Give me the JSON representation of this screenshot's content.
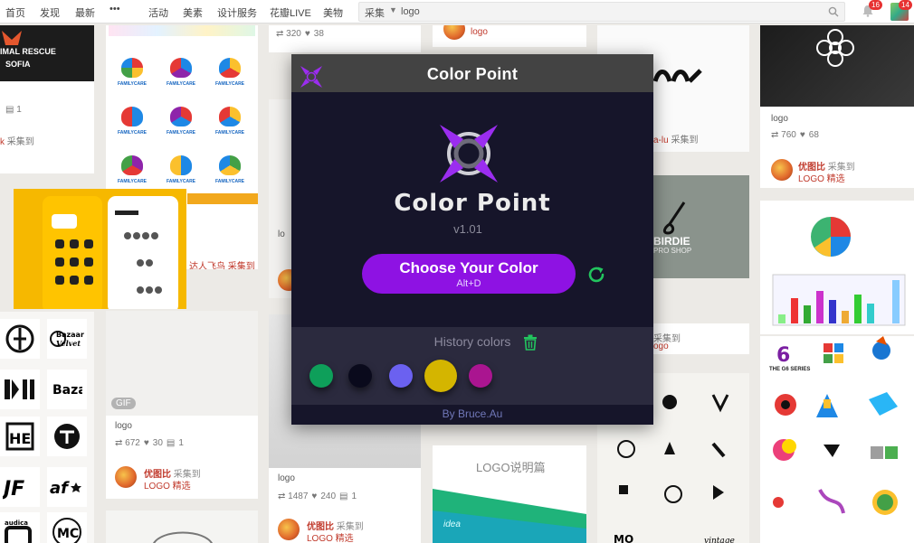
{
  "nav": {
    "items": [
      "首页",
      "发现",
      "最新",
      "活动",
      "美素",
      "设计服务",
      "花瓣LIVE",
      "美物"
    ],
    "more": "•••",
    "search_category": "采集",
    "search_query": "logo",
    "notifications_count": "16",
    "messages_count": "14"
  },
  "pins": {
    "animal_rescue": {
      "title_line1": "IMAL RESCUE",
      "title_line2": "SOFIA",
      "comments": "1",
      "collect": "采集到"
    },
    "family_care": {
      "text": "FAMILYCARE",
      "collect_caption": "达人飞鸟 采集到"
    },
    "gif_pin": {
      "gif_label": "GIF",
      "title": "logo",
      "repins": "672",
      "likes": "30",
      "comments": "1",
      "user": "优图比",
      "action": "采集到",
      "board": "LOGO 精选"
    },
    "center_top": {
      "repins": "320",
      "likes": "38",
      "user_board": "logo"
    },
    "center_mid": {
      "title": "logo",
      "repins": "1487",
      "likes": "240",
      "comments": "1",
      "user": "优图比",
      "action": "采集到",
      "board": "LOGO 精选"
    },
    "doc_pin": {
      "title": "LOGO说明篇",
      "tag": "idea"
    },
    "collect_a": "采集到",
    "collect_b": "采集到",
    "birdie": {
      "title": "BIRDIE",
      "subtitle": "PRO SHOP"
    },
    "right_top": {
      "title": "logo",
      "repins": "760",
      "likes": "68",
      "user": "优图比",
      "action": "采集到",
      "board": "LOGO 精选"
    },
    "g6": {
      "label": "THE G6 SERIES"
    }
  },
  "cp": {
    "title": "Color Point",
    "wordmark": "Color Point",
    "version": "v1.01",
    "button_label": "Choose Your Color",
    "button_hint": "Alt+D",
    "history_label": "History colors",
    "footer": "By Bruce.Au",
    "history_colors": [
      "#0e9f5a",
      "#0a0a1c",
      "#6b61f0",
      "#d4b500",
      "#aa1590"
    ],
    "accent": "#8e12e3",
    "refresh_color": "#22c55e"
  }
}
